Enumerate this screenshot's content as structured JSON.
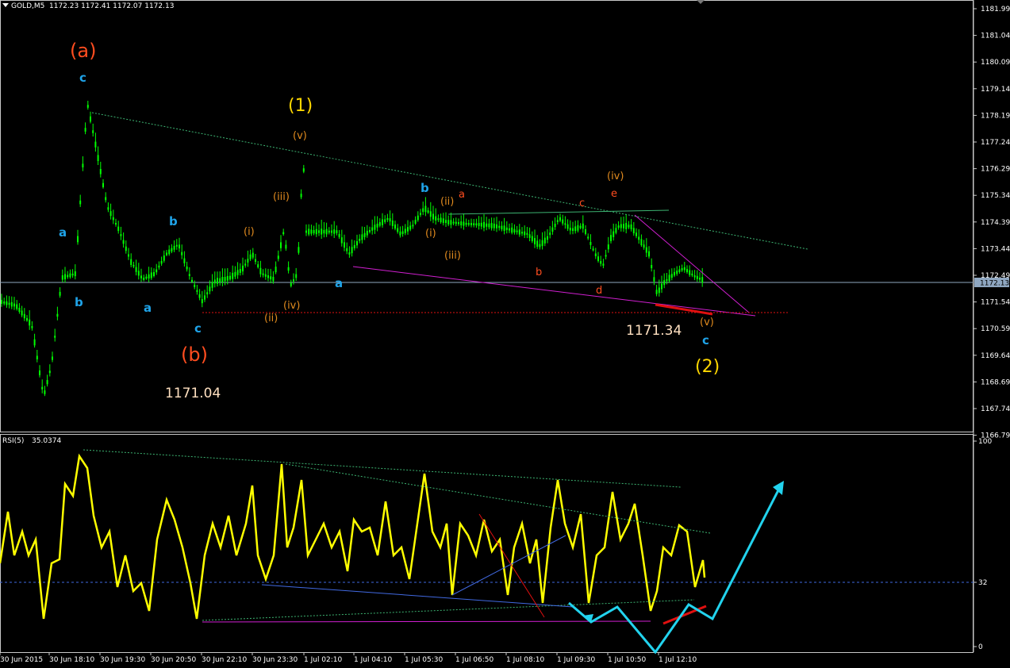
{
  "header": {
    "symbol": "GOLD,M5",
    "ohlc": "1172.23 1172.41 1172.07 1172.13"
  },
  "rsi_header": {
    "name": "RSI(5)",
    "value": "35.0374"
  },
  "colors": {
    "background": "#000000",
    "candles": "#00ff00",
    "rsi_line": "#ffff00",
    "price_line": "#8fa7c1",
    "wave_blue": "#1fa3e8",
    "wave_orange": "#ff4d1f",
    "wave_gold": "#ffd700",
    "wave_minor": "#e08a1e",
    "trend_magenta": "#d01fd0",
    "trend_green": "#3cb371",
    "arrow_cyan": "#22d3ee",
    "red_line": "#e01010"
  },
  "chart_data": [
    {
      "type": "candlestick",
      "title": "GOLD,M5",
      "y_ticks": [
        "1181.99",
        "1181.04",
        "1180.09",
        "1179.14",
        "1178.19",
        "1177.24",
        "1176.29",
        "1175.34",
        "1174.39",
        "1173.44",
        "1172.49",
        "1171.54",
        "1170.59",
        "1169.64",
        "1168.69",
        "1167.74",
        "1166.79"
      ],
      "ylim": [
        1166.79,
        1181.99
      ],
      "current_price": "1172.13",
      "x_ticks": [
        "30 Jun 2015",
        "30 Jun 18:10",
        "30 Jun 19:30",
        "30 Jun 20:50",
        "30 Jun 22:10",
        "30 Jun 23:30",
        "1 Jul 02:10",
        "1 Jul 04:10",
        "1 Jul 05:30",
        "1 Jul 06:50",
        "1 Jul 08:10",
        "1 Jul 09:30",
        "1 Jul 10:50",
        "1 Jul 12:10"
      ],
      "annotations": {
        "wave_a": "(a)",
        "wave_b": "(b)",
        "wave_1": "(1)",
        "wave_2": "(2)",
        "level_1": "1171.04",
        "level_2": "1171.34",
        "blue": [
          "a",
          "b",
          "c",
          "a",
          "b",
          "c",
          "a",
          "b",
          "c"
        ],
        "minor": [
          "(i)",
          "(ii)",
          "(iii)",
          "(iv)",
          "(v)",
          "(i)",
          "(ii)",
          "(iii)",
          "(iv)",
          "(v)"
        ],
        "red_letters": [
          "a",
          "b",
          "c",
          "d",
          "e"
        ]
      }
    },
    {
      "type": "line",
      "title": "RSI(5) 35.0374",
      "y_ticks": [
        "100",
        "32",
        "0"
      ],
      "ylim": [
        0,
        100
      ],
      "series": [
        {
          "name": "RSI(5)"
        }
      ]
    }
  ]
}
